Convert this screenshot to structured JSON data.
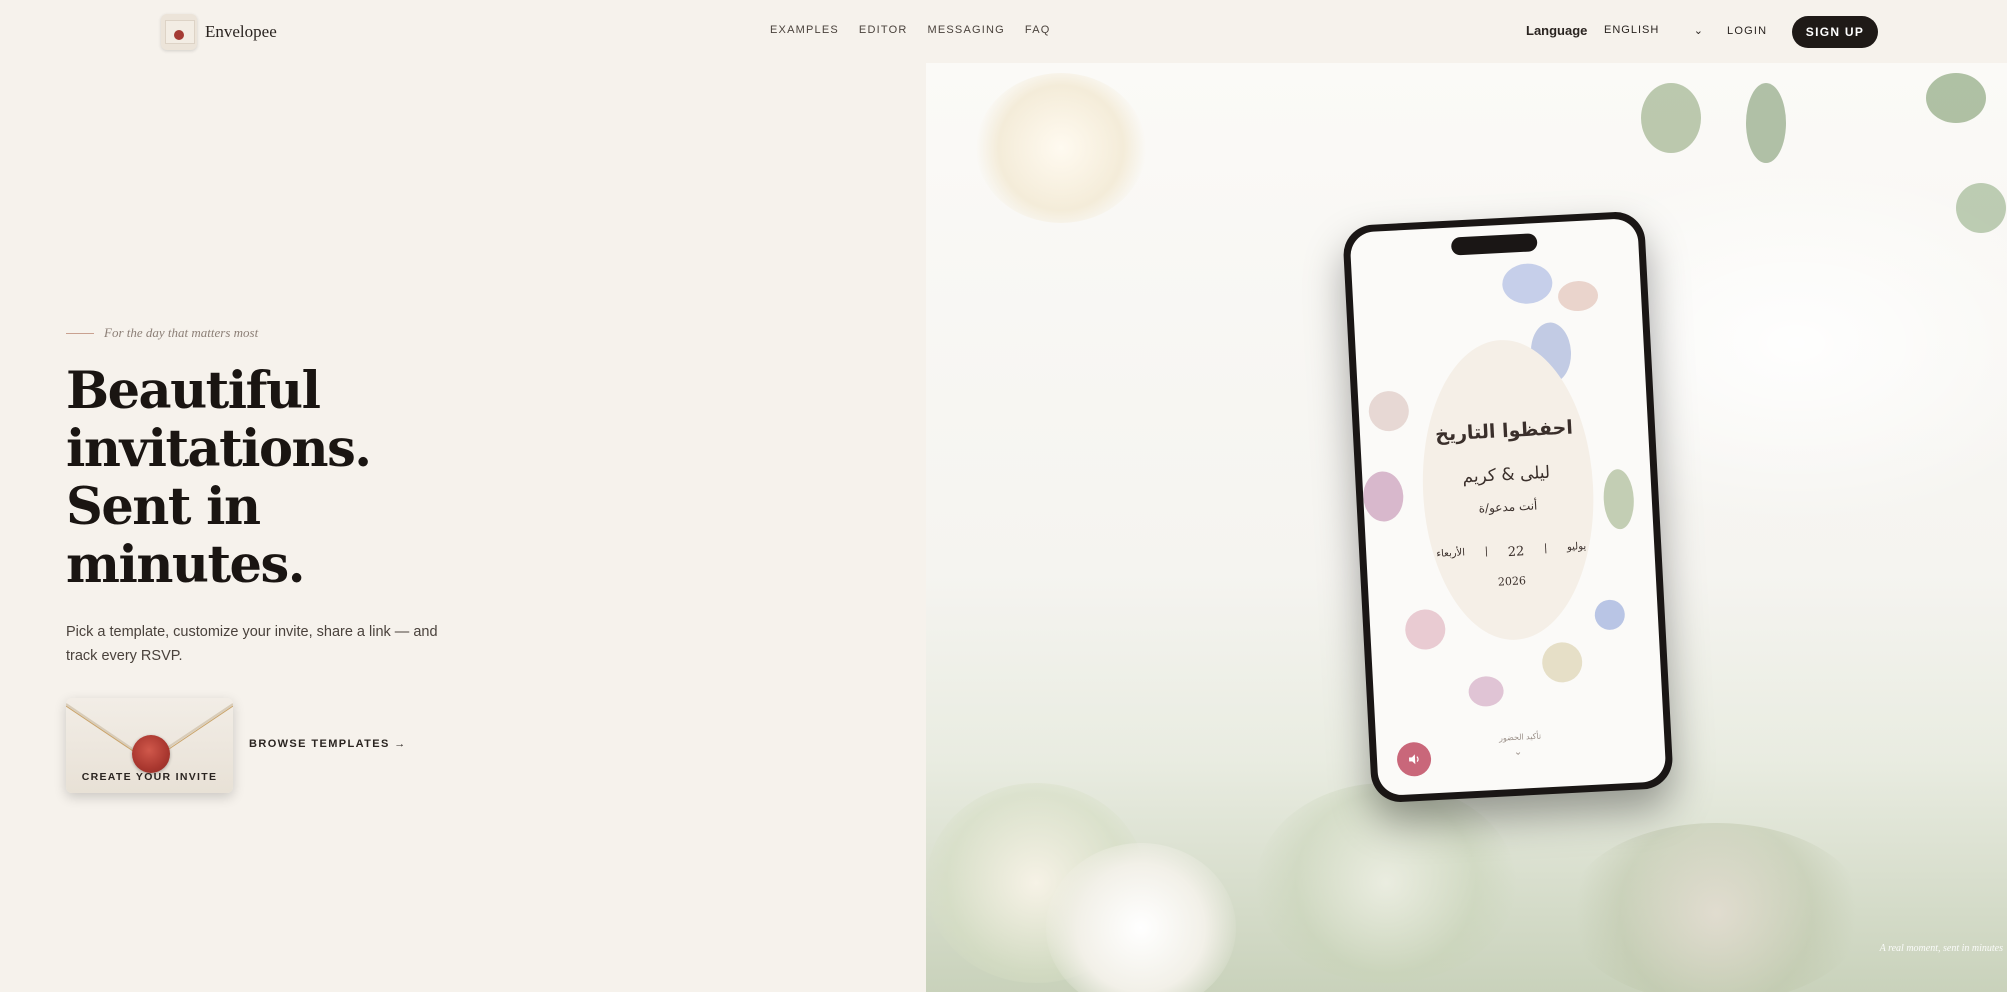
{
  "header": {
    "brand": "Envelopee",
    "nav": [
      "EXAMPLES",
      "EDITOR",
      "MESSAGING",
      "FAQ"
    ],
    "language_label": "Language",
    "language_value": "ENGLISH",
    "login": "LOGIN",
    "signup": "SIGN UP"
  },
  "hero": {
    "eyebrow": "For the day that matters most",
    "headline_lines": [
      "Beautiful",
      "invitations.",
      "Sent in",
      "minutes."
    ],
    "subtext": "Pick a template, customize your invite, share a link — and track every RSVP.",
    "cta_primary": "CREATE YOUR INVITE",
    "cta_secondary": "BROWSE TEMPLATES →",
    "image_caption": "A real moment, sent in minutes"
  },
  "phone_invite": {
    "title": "احفظوا التاريخ",
    "names": "ليلى & كريم",
    "invited": "أنت مدعو/ة",
    "weekday": "الأربعاء",
    "day": "22",
    "month": "يوليو",
    "year": "2026",
    "confirm": "تأكيد الحضور",
    "sound_icon": "speaker-icon"
  },
  "colors": {
    "background": "#f6f2ec",
    "dark": "#1f1a17",
    "seal": "#a9372f",
    "sound_button": "#c9677a"
  }
}
